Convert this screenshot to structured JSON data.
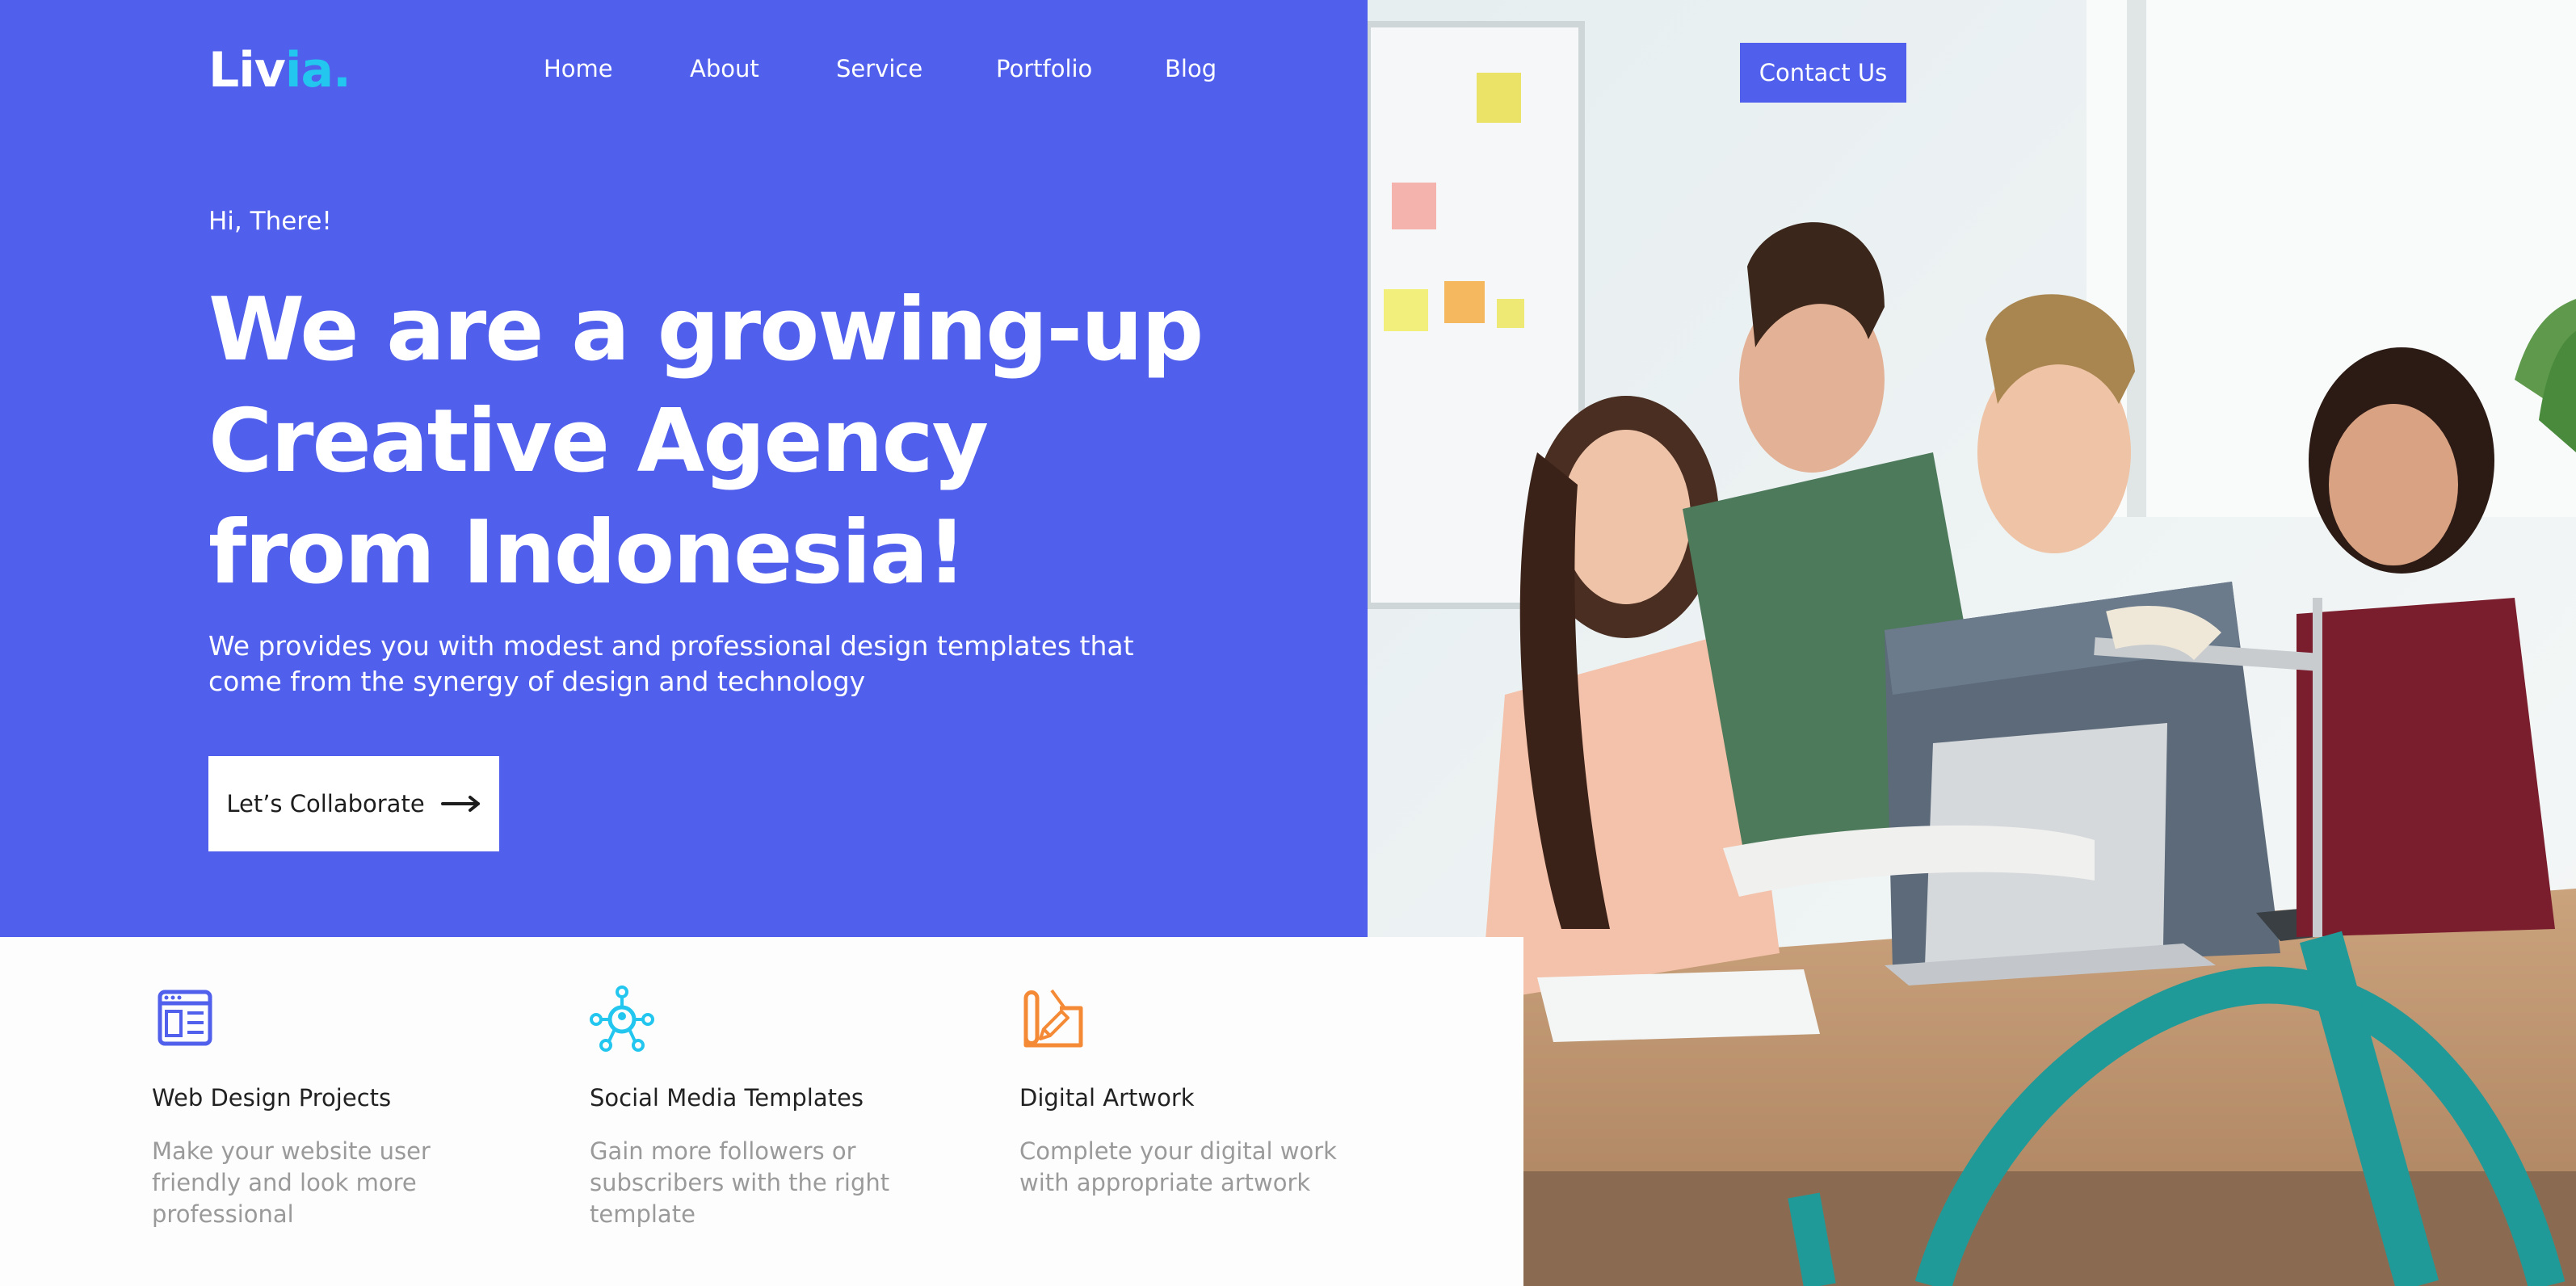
{
  "brand": {
    "name_main": "Liv",
    "name_accent": "ia",
    "dot": "."
  },
  "nav": {
    "items": [
      {
        "label": "Home"
      },
      {
        "label": "About"
      },
      {
        "label": "Service"
      },
      {
        "label": "Portfolio"
      },
      {
        "label": "Blog"
      }
    ],
    "contact_label": "Contact Us"
  },
  "hero": {
    "greeting": "Hi, There!",
    "headline_line1": "We are a growing-up",
    "headline_line2": "Creative Agency",
    "headline_line3": "from Indonesia!",
    "subtitle": "We provides you with modest and professional design templates that come from the synergy of design and technology",
    "cta_label": "Let’s Collaborate"
  },
  "features": [
    {
      "icon": "web-design-icon",
      "title": "Web Design Projects",
      "description": "Make your website user friendly and look more professional",
      "color": "#505fec"
    },
    {
      "icon": "social-network-icon",
      "title": "Social Media Templates",
      "description": "Gain more followers or subscribers with the right template",
      "color": "#22c6ee"
    },
    {
      "icon": "artwork-icon",
      "title": "Digital Artwork",
      "description": "Complete your digital work with appropriate artwork",
      "color": "#f58a36"
    }
  ],
  "colors": {
    "primary": "#505fec",
    "accent": "#22c6ee",
    "orange": "#f58a36"
  }
}
